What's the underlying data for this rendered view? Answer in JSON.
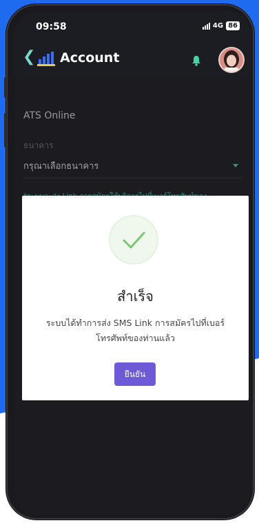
{
  "status_bar": {
    "time": "09:58",
    "network": "4G",
    "battery": "86"
  },
  "nav": {
    "title": "Account"
  },
  "form": {
    "service_name": "ATS Online",
    "bank_label": "ธนาคาร",
    "bank_placeholder": "กรุณาเลือกธนาคาร",
    "note": "*ระบบจะส่ง Link การสมัครใช้บริการไปที่เบอร์โทรศัพท์ของ"
  },
  "modal": {
    "title": "สำเร็จ",
    "message_line1": "ระบบได้ทำการส่ง SMS Link การสมัครไปที่เบอร์",
    "message_line2": "โทรศัพท์ของท่านแล้ว",
    "confirm_label": "ยืนยัน"
  },
  "colors": {
    "accent": "#6c5ad6",
    "teal": "#3cc4b6",
    "success": "#7cc572",
    "background_blue": "#1f6bf0"
  },
  "icons": {
    "back": "chevron-left-icon",
    "logo": "bar-logo-icon",
    "notification": "bell-icon",
    "avatar": "avatar",
    "success": "checkmark-icon"
  }
}
